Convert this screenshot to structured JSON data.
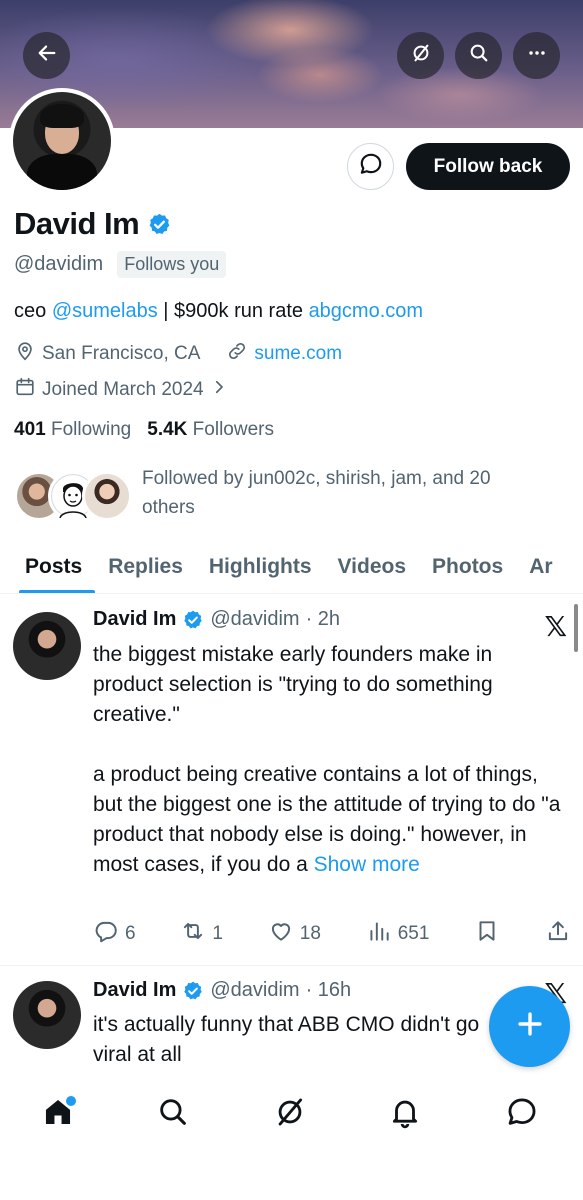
{
  "header": {
    "back_icon": "arrow-left-icon",
    "grok_icon": "grok-icon",
    "search_icon": "search-icon",
    "more_icon": "more-dots-icon"
  },
  "profile": {
    "display_name": "David Im",
    "handle": "@davidim",
    "follows_you_label": "Follows you",
    "follow_back_label": "Follow back",
    "bio": {
      "prefix": "ceo ",
      "mention": "@sumelabs",
      "middle": " | $900k run rate ",
      "url": "abgcmo.com"
    },
    "location": "San Francisco, CA",
    "website": "sume.com",
    "joined": "Joined March 2024",
    "following_count": "401",
    "following_label": "Following",
    "followers_count": "5.4K",
    "followers_label": "Followers",
    "followed_by": "Followed by jun002c, shirish, jam, and 20 others"
  },
  "tabs": [
    "Posts",
    "Replies",
    "Highlights",
    "Videos",
    "Photos",
    "Ar"
  ],
  "posts": [
    {
      "name": "David Im",
      "handle": "@davidim",
      "time": "· 2h",
      "para1": "the biggest mistake early founders make in product selection is \"trying to do something creative.\"",
      "para2": "a product being creative contains a lot of things, but the biggest one is the attitude of trying to do \"a product that nobody else is doing.\" however, in most cases, if you do a",
      "show_more": "Show more",
      "replies": "6",
      "reposts": "1",
      "likes": "18",
      "views": "651"
    },
    {
      "name": "David Im",
      "handle": "@davidim",
      "time": "· 16h",
      "text": "it's actually funny that ABB CMO didn't go viral at all"
    }
  ],
  "colors": {
    "accent": "#1d9bf0",
    "text": "#0f1419",
    "muted": "#536471"
  }
}
